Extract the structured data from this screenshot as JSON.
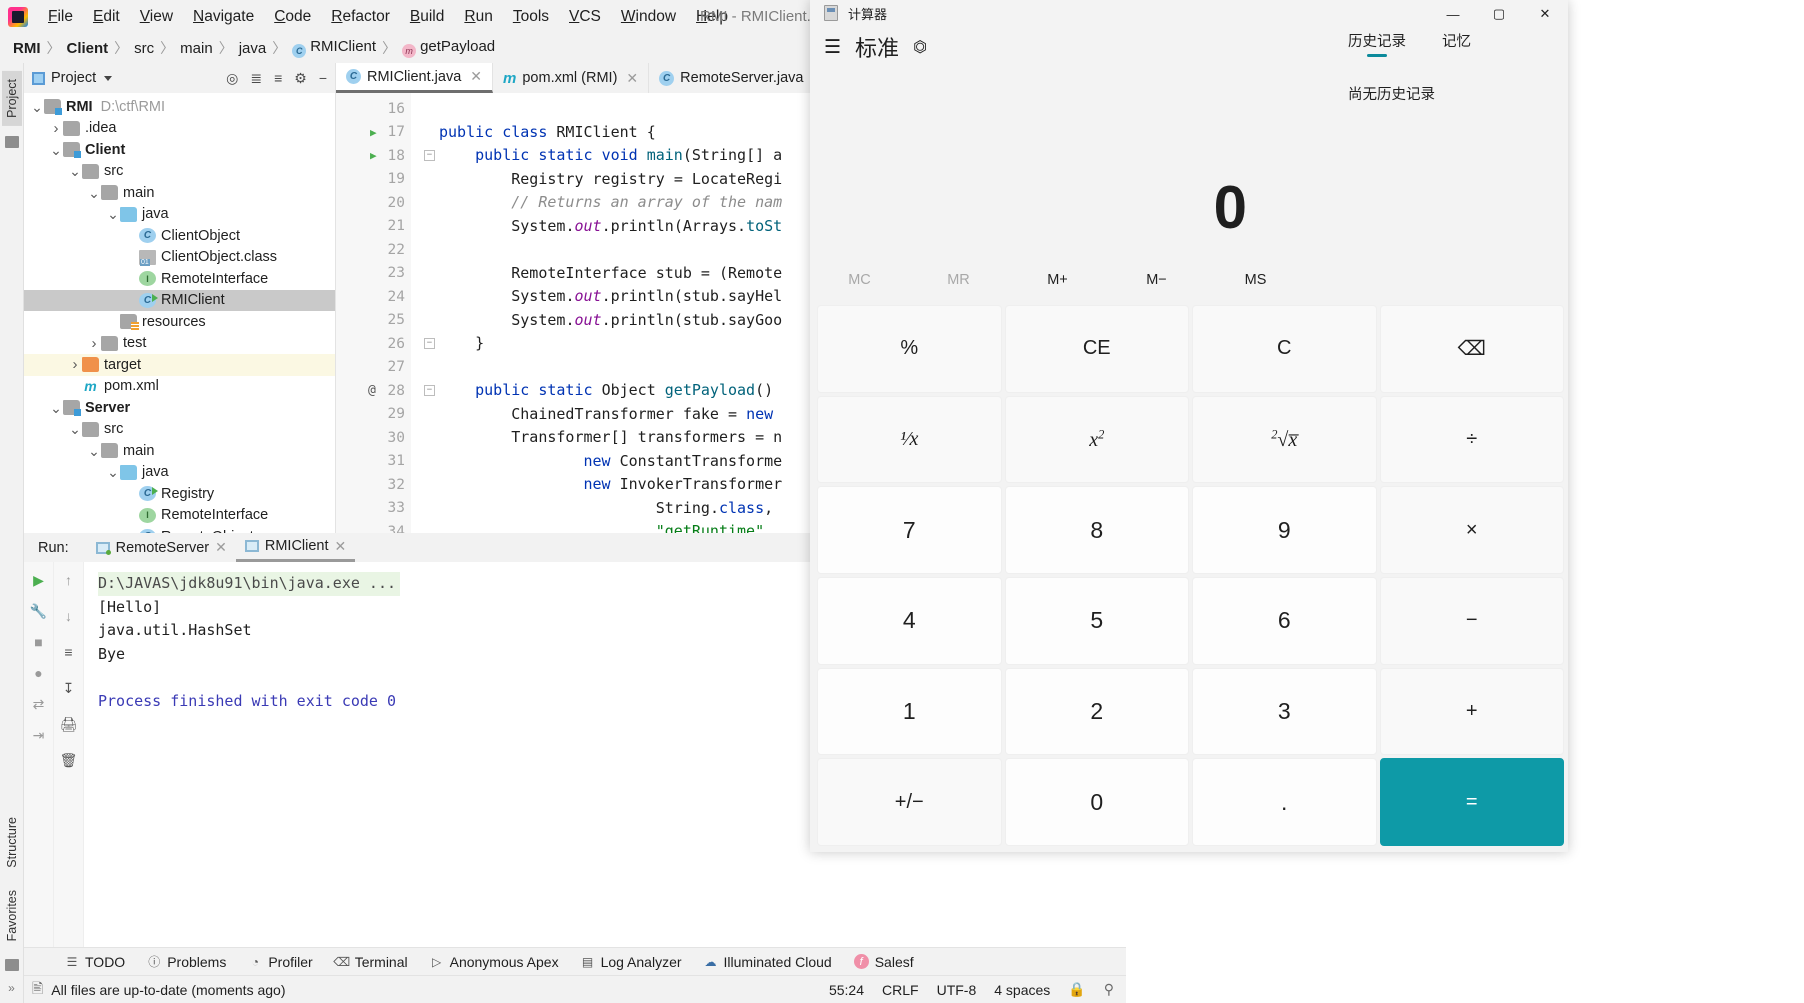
{
  "ide": {
    "menu": [
      "File",
      "Edit",
      "View",
      "Navigate",
      "Code",
      "Refactor",
      "Build",
      "Run",
      "Tools",
      "VCS",
      "Window",
      "Help"
    ],
    "window_title": "RMI - RMIClient.java [Cli",
    "breadcrumbs": [
      {
        "label": "RMI",
        "bold": true,
        "icon": ""
      },
      {
        "label": "Client",
        "bold": true,
        "icon": ""
      },
      {
        "label": "src",
        "bold": false,
        "icon": ""
      },
      {
        "label": "main",
        "bold": false,
        "icon": ""
      },
      {
        "label": "java",
        "bold": false,
        "icon": ""
      },
      {
        "label": "RMIClient",
        "bold": false,
        "icon": "class-icon"
      },
      {
        "label": "getPayload",
        "bold": false,
        "icon": "method-icon"
      }
    ],
    "project_panel": {
      "title": "Project",
      "tools": [
        "locate-icon",
        "expand-all-icon",
        "collapse-all-icon",
        "gear-icon",
        "minimize-icon"
      ],
      "tree": [
        {
          "depth": 0,
          "arrow": "down",
          "icon": "module-folder",
          "label": "RMI",
          "bold": true,
          "path": "D:\\ctf\\RMI",
          "state": ""
        },
        {
          "depth": 1,
          "arrow": "right",
          "icon": "folder",
          "label": ".idea",
          "bold": false,
          "path": "",
          "state": ""
        },
        {
          "depth": 1,
          "arrow": "down",
          "icon": "module-folder",
          "label": "Client",
          "bold": true,
          "path": "",
          "state": ""
        },
        {
          "depth": 2,
          "arrow": "down",
          "icon": "folder",
          "label": "src",
          "bold": false,
          "path": "",
          "state": ""
        },
        {
          "depth": 3,
          "arrow": "down",
          "icon": "folder",
          "label": "main",
          "bold": false,
          "path": "",
          "state": ""
        },
        {
          "depth": 4,
          "arrow": "down",
          "icon": "source-folder",
          "label": "java",
          "bold": false,
          "path": "",
          "state": ""
        },
        {
          "depth": 5,
          "arrow": "none",
          "icon": "class",
          "label": "ClientObject",
          "bold": false,
          "path": "",
          "state": ""
        },
        {
          "depth": 5,
          "arrow": "none",
          "icon": "classfile",
          "label": "ClientObject.class",
          "bold": false,
          "path": "",
          "state": ""
        },
        {
          "depth": 5,
          "arrow": "none",
          "icon": "interface",
          "label": "RemoteInterface",
          "bold": false,
          "path": "",
          "state": ""
        },
        {
          "depth": 5,
          "arrow": "none",
          "icon": "runnable-class",
          "label": "RMIClient",
          "bold": false,
          "path": "",
          "state": "selected"
        },
        {
          "depth": 4,
          "arrow": "none",
          "icon": "resource-folder",
          "label": "resources",
          "bold": false,
          "path": "",
          "state": ""
        },
        {
          "depth": 3,
          "arrow": "right",
          "icon": "folder",
          "label": "test",
          "bold": false,
          "path": "",
          "state": ""
        },
        {
          "depth": 2,
          "arrow": "right",
          "icon": "target-folder",
          "label": "target",
          "bold": false,
          "path": "",
          "state": "highlight"
        },
        {
          "depth": 2,
          "arrow": "none",
          "icon": "maven",
          "label": "pom.xml",
          "bold": false,
          "path": "",
          "state": ""
        },
        {
          "depth": 1,
          "arrow": "down",
          "icon": "module-folder",
          "label": "Server",
          "bold": true,
          "path": "",
          "state": ""
        },
        {
          "depth": 2,
          "arrow": "down",
          "icon": "folder",
          "label": "src",
          "bold": false,
          "path": "",
          "state": ""
        },
        {
          "depth": 3,
          "arrow": "down",
          "icon": "folder",
          "label": "main",
          "bold": false,
          "path": "",
          "state": ""
        },
        {
          "depth": 4,
          "arrow": "down",
          "icon": "source-folder",
          "label": "java",
          "bold": false,
          "path": "",
          "state": ""
        },
        {
          "depth": 5,
          "arrow": "none",
          "icon": "runnable-class",
          "label": "Registry",
          "bold": false,
          "path": "",
          "state": ""
        },
        {
          "depth": 5,
          "arrow": "none",
          "icon": "interface",
          "label": "RemoteInterface",
          "bold": false,
          "path": "",
          "state": ""
        },
        {
          "depth": 5,
          "arrow": "none",
          "icon": "class",
          "label": "RemoteObject",
          "bold": false,
          "path": "",
          "state": ""
        }
      ]
    },
    "editor_tabs": [
      {
        "label": "RMIClient.java",
        "icon": "runnable-class-icon",
        "active": true
      },
      {
        "label": "pom.xml (RMI)",
        "icon": "maven-icon",
        "active": false
      },
      {
        "label": "RemoteServer.java",
        "icon": "runnable-class-icon",
        "active": false
      }
    ],
    "code_lines": [
      {
        "n": 16,
        "gmark": "",
        "fold": "",
        "text": ""
      },
      {
        "n": 17,
        "gmark": "run",
        "fold": "",
        "text": "public class RMIClient {"
      },
      {
        "n": 18,
        "gmark": "run",
        "fold": "minus",
        "text": "    public static void main(String[] a"
      },
      {
        "n": 19,
        "gmark": "",
        "fold": "",
        "text": "        Registry registry = LocateRegi"
      },
      {
        "n": 20,
        "gmark": "",
        "fold": "",
        "text": "        // Returns an array of the nam"
      },
      {
        "n": 21,
        "gmark": "",
        "fold": "",
        "text": "        System.out.println(Arrays.toSt"
      },
      {
        "n": 22,
        "gmark": "",
        "fold": "",
        "text": ""
      },
      {
        "n": 23,
        "gmark": "",
        "fold": "",
        "text": "        RemoteInterface stub = (Remote"
      },
      {
        "n": 24,
        "gmark": "",
        "fold": "",
        "text": "        System.out.println(stub.sayHel"
      },
      {
        "n": 25,
        "gmark": "",
        "fold": "",
        "text": "        System.out.println(stub.sayGoo"
      },
      {
        "n": 26,
        "gmark": "",
        "fold": "minus",
        "text": "    }"
      },
      {
        "n": 27,
        "gmark": "",
        "fold": "",
        "text": ""
      },
      {
        "n": 28,
        "gmark": "at",
        "fold": "minus",
        "text": "    public static Object getPayload()"
      },
      {
        "n": 29,
        "gmark": "",
        "fold": "",
        "text": "        ChainedTransformer fake = new"
      },
      {
        "n": 30,
        "gmark": "",
        "fold": "",
        "text": "        Transformer[] transformers = n"
      },
      {
        "n": 31,
        "gmark": "",
        "fold": "",
        "text": "                new ConstantTransforme"
      },
      {
        "n": 32,
        "gmark": "",
        "fold": "",
        "text": "                new InvokerTransformer"
      },
      {
        "n": 33,
        "gmark": "",
        "fold": "",
        "text": "                        String.class,"
      },
      {
        "n": 34,
        "gmark": "",
        "fold": "",
        "text": "                        \"getRuntime\","
      }
    ],
    "run_panel": {
      "label": "Run:",
      "tabs": [
        {
          "label": "RemoteServer",
          "active": false,
          "running": true
        },
        {
          "label": "RMIClient",
          "active": true,
          "running": false
        }
      ],
      "toolbar_left": [
        "run-icon",
        "stop-icon",
        "camera-icon",
        "graph-icon",
        "export-icon"
      ],
      "toolbar_mid": [
        "up-arrow-icon",
        "down-arrow-icon",
        "wrap-icon",
        "scroll-end-icon",
        "print-icon",
        "trash-icon"
      ],
      "console": [
        {
          "text": "D:\\JAVAS\\jdk8u91\\bin\\java.exe ...",
          "style": "cmd"
        },
        {
          "text": "[Hello]",
          "style": "plain"
        },
        {
          "text": "java.util.HashSet",
          "style": "plain"
        },
        {
          "text": "Bye",
          "style": "plain"
        },
        {
          "text": "",
          "style": "plain"
        },
        {
          "text": "Process finished with exit code 0",
          "style": "exit"
        }
      ]
    },
    "tool_window_bar": [
      {
        "label": "TODO",
        "icon": "list-icon"
      },
      {
        "label": "Problems",
        "icon": "error-icon"
      },
      {
        "label": "Profiler",
        "icon": "profiler-icon"
      },
      {
        "label": "Terminal",
        "icon": "terminal-icon"
      },
      {
        "label": "Anonymous Apex",
        "icon": "apex-icon"
      },
      {
        "label": "Log Analyzer",
        "icon": "log-icon"
      },
      {
        "label": "Illuminated Cloud",
        "icon": "cloud-icon"
      },
      {
        "label": "Salesf",
        "icon": "salesforce-icon"
      }
    ],
    "status_bar": {
      "message": "All files are up-to-date (moments ago)",
      "message_icon": "document-icon",
      "caret": "55:24",
      "line_sep": "CRLF",
      "encoding": "UTF-8",
      "indent": "4 spaces",
      "lock_icon": "lock-icon",
      "branch_icon": "branch-icon"
    },
    "left_rail": [
      "Project",
      "Structure",
      "Favorites"
    ]
  },
  "calculator": {
    "title": "计算器",
    "title_icon": "calculator-icon",
    "window_controls": {
      "minimize": "—",
      "maximize": "▢",
      "close": "✕"
    },
    "menu_icon": "hamburger-icon",
    "mode": "标准",
    "pin_icon": "keep-on-top-icon",
    "history_tabs": [
      {
        "label": "历史记录",
        "active": true
      },
      {
        "label": "记忆",
        "active": false
      }
    ],
    "history_empty": "尚无历史记录",
    "display_value": "0",
    "memory_buttons": [
      {
        "label": "MC",
        "disabled": true
      },
      {
        "label": "MR",
        "disabled": true
      },
      {
        "label": "M+",
        "disabled": false
      },
      {
        "label": "M−",
        "disabled": false
      },
      {
        "label": "MS",
        "disabled": false
      }
    ],
    "keypad": [
      {
        "label": "%",
        "kind": "op",
        "name": "percent"
      },
      {
        "label": "CE",
        "kind": "op",
        "name": "clear-entry"
      },
      {
        "label": "C",
        "kind": "op",
        "name": "clear"
      },
      {
        "label": "⌫",
        "kind": "op",
        "name": "backspace"
      },
      {
        "label": "1/x",
        "kind": "op",
        "name": "reciprocal"
      },
      {
        "label": "x2",
        "kind": "op",
        "name": "square"
      },
      {
        "label": "√x",
        "kind": "op",
        "name": "square-root"
      },
      {
        "label": "÷",
        "kind": "op",
        "name": "divide"
      },
      {
        "label": "7",
        "kind": "num",
        "name": "seven"
      },
      {
        "label": "8",
        "kind": "num",
        "name": "eight"
      },
      {
        "label": "9",
        "kind": "num",
        "name": "nine"
      },
      {
        "label": "×",
        "kind": "op",
        "name": "multiply"
      },
      {
        "label": "4",
        "kind": "num",
        "name": "four"
      },
      {
        "label": "5",
        "kind": "num",
        "name": "five"
      },
      {
        "label": "6",
        "kind": "num",
        "name": "six"
      },
      {
        "label": "−",
        "kind": "op",
        "name": "subtract"
      },
      {
        "label": "1",
        "kind": "num",
        "name": "one"
      },
      {
        "label": "2",
        "kind": "num",
        "name": "two"
      },
      {
        "label": "3",
        "kind": "num",
        "name": "three"
      },
      {
        "label": "+",
        "kind": "op",
        "name": "add"
      },
      {
        "label": "+/−",
        "kind": "op",
        "name": "negate"
      },
      {
        "label": "0",
        "kind": "num",
        "name": "zero"
      },
      {
        "label": ".",
        "kind": "num",
        "name": "decimal"
      },
      {
        "label": "=",
        "kind": "eq",
        "name": "equals"
      }
    ],
    "accent_color": "#0e9aa7"
  }
}
